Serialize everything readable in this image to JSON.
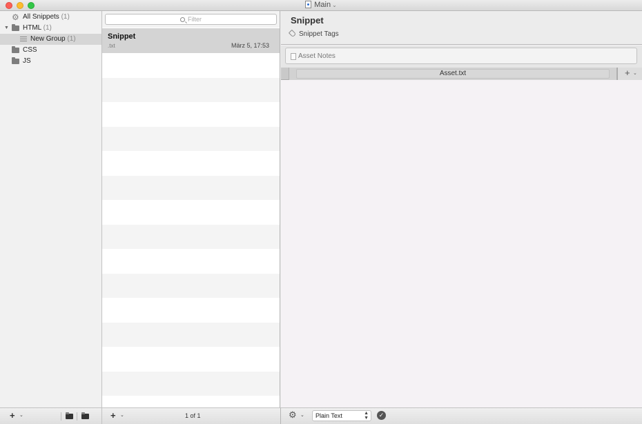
{
  "window": {
    "title": "Main"
  },
  "sidebar": {
    "items": [
      {
        "label": "All Snippets",
        "count": "(1)",
        "icon": "gear-icon"
      },
      {
        "label": "HTML",
        "count": "(1)",
        "icon": "folder-icon",
        "expanded": true
      },
      {
        "label": "New Group",
        "count": "(1)",
        "icon": "list-icon",
        "selected": true
      },
      {
        "label": "CSS",
        "count": "",
        "icon": "folder-icon"
      },
      {
        "label": "JS",
        "count": "",
        "icon": "folder-icon"
      }
    ]
  },
  "list": {
    "filter_placeholder": "Filter",
    "snippets": [
      {
        "title": "Snippet",
        "ext": ".txt",
        "date": "März 5, 17:53"
      }
    ],
    "pager": "1 of 1"
  },
  "detail": {
    "title": "Snippet",
    "tags_placeholder": "Snippet Tags",
    "notes_placeholder": "Asset Notes",
    "tabs": [
      {
        "label": "Asset.txt"
      }
    ],
    "syntax": "Plain Text"
  },
  "colors": {
    "close": "#fc5f57",
    "minimize": "#fdbc2e",
    "maximize": "#33c748",
    "selection": "#d4d4d4"
  }
}
